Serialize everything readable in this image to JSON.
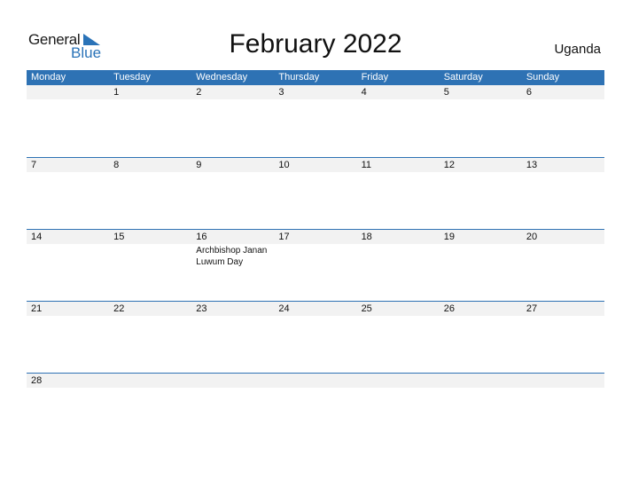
{
  "logo": {
    "general": "General",
    "blue": "Blue",
    "brand_color": "#2a73b8"
  },
  "title": "February 2022",
  "country": "Uganda",
  "weekdays": [
    "Monday",
    "Tuesday",
    "Wednesday",
    "Thursday",
    "Friday",
    "Saturday",
    "Sunday"
  ],
  "header_color": "#2e72b4",
  "weeks": [
    {
      "days": [
        "",
        "1",
        "2",
        "3",
        "4",
        "5",
        "6"
      ],
      "events": [
        "",
        "",
        "",
        "",
        "",
        "",
        ""
      ]
    },
    {
      "days": [
        "7",
        "8",
        "9",
        "10",
        "11",
        "12",
        "13"
      ],
      "events": [
        "",
        "",
        "",
        "",
        "",
        "",
        ""
      ]
    },
    {
      "days": [
        "14",
        "15",
        "16",
        "17",
        "18",
        "19",
        "20"
      ],
      "events": [
        "",
        "",
        "Archbishop Janan Luwum Day",
        "",
        "",
        "",
        ""
      ]
    },
    {
      "days": [
        "21",
        "22",
        "23",
        "24",
        "25",
        "26",
        "27"
      ],
      "events": [
        "",
        "",
        "",
        "",
        "",
        "",
        ""
      ]
    },
    {
      "days": [
        "28",
        "",
        "",
        "",
        "",
        "",
        ""
      ],
      "events": [
        "",
        "",
        "",
        "",
        "",
        "",
        ""
      ]
    }
  ]
}
